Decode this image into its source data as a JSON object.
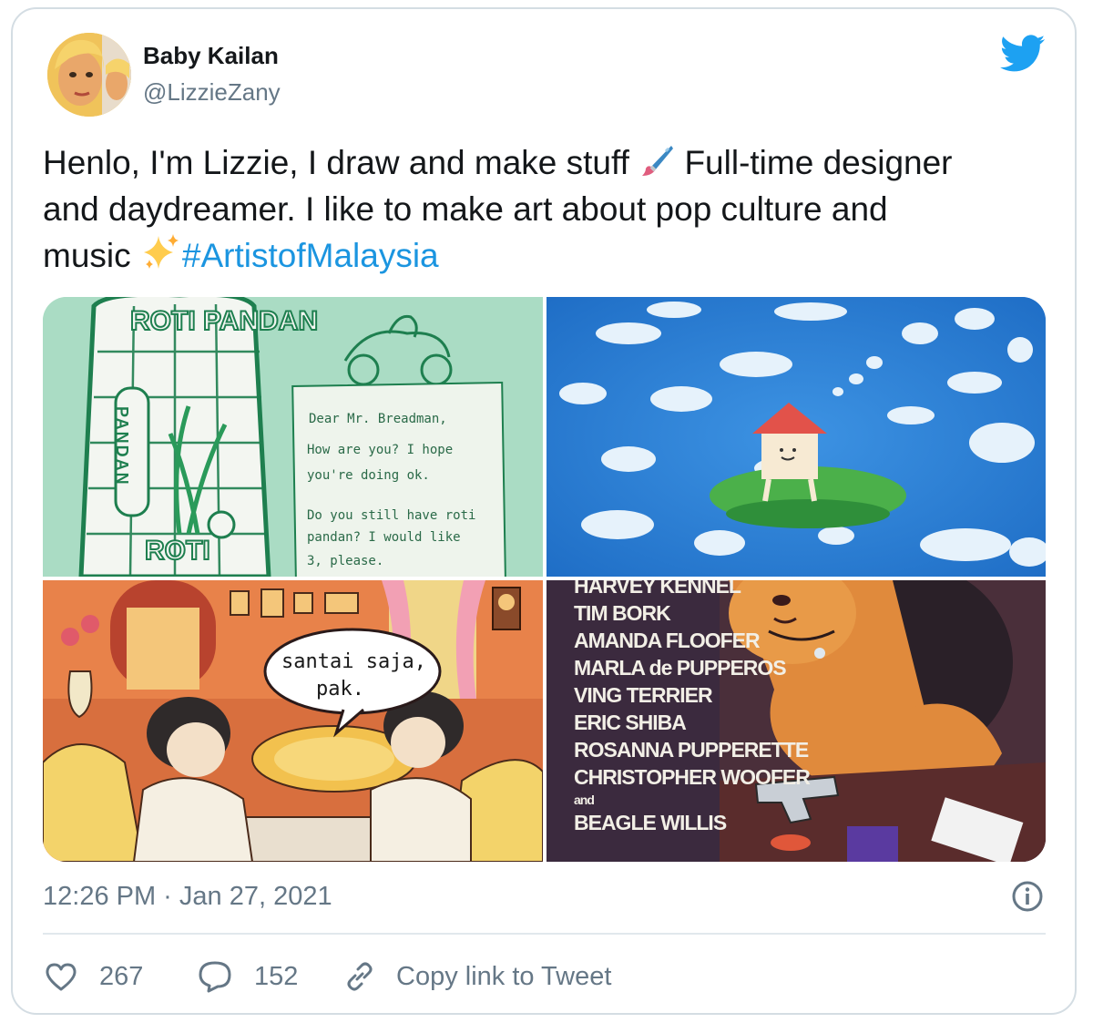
{
  "user": {
    "display_name": "Baby Kailan",
    "handle": "@LizzieZany",
    "avatar_icon": "profile-photo"
  },
  "tweet": {
    "line1": "Henlo, I'm Lizzie, I draw and make stuff",
    "line1_tail": "Full-time designer",
    "line2": "and daydreamer. I like to make art about pop culture and",
    "line3": "music",
    "hashtag": "#ArtistofMalaysia",
    "emoji_1": "paintbrush-emoji",
    "emoji_2": "sparkles-emoji"
  },
  "media": {
    "image1": {
      "bag_top": "ROTI PANDAN",
      "bag_side": "PANDAN",
      "bag_bottom": "ROTI",
      "note": [
        "Dear Mr. Breadman,",
        "How are you? I hope",
        "you're doing ok.",
        "Do you still have roti",
        "pandan? I would like",
        "3, please."
      ]
    },
    "image2": {},
    "image3": {
      "speech_line1": "santai saja,",
      "speech_line2": "pak."
    },
    "image4": {
      "credits": [
        "HARVEY KENNEL",
        "TIM BORK",
        "AMANDA FLOOFER",
        "MARLA de PUPPEROS",
        "VING TERRIER",
        "ERIC SHIBA",
        "ROSANNA PUPPERETTE",
        "CHRISTOPHER WOOFER",
        "and",
        "BEAGLE WILLIS"
      ]
    }
  },
  "meta": {
    "timestamp": "12:26 PM · Jan 27, 2021"
  },
  "actions": {
    "likes": "267",
    "replies": "152",
    "copy_link": "Copy link to Tweet"
  },
  "colors": {
    "text": "#14171a",
    "secondary": "#657786",
    "link": "#1b95e0",
    "twitter_blue": "#1da1f2",
    "border": "#d4dde3"
  }
}
